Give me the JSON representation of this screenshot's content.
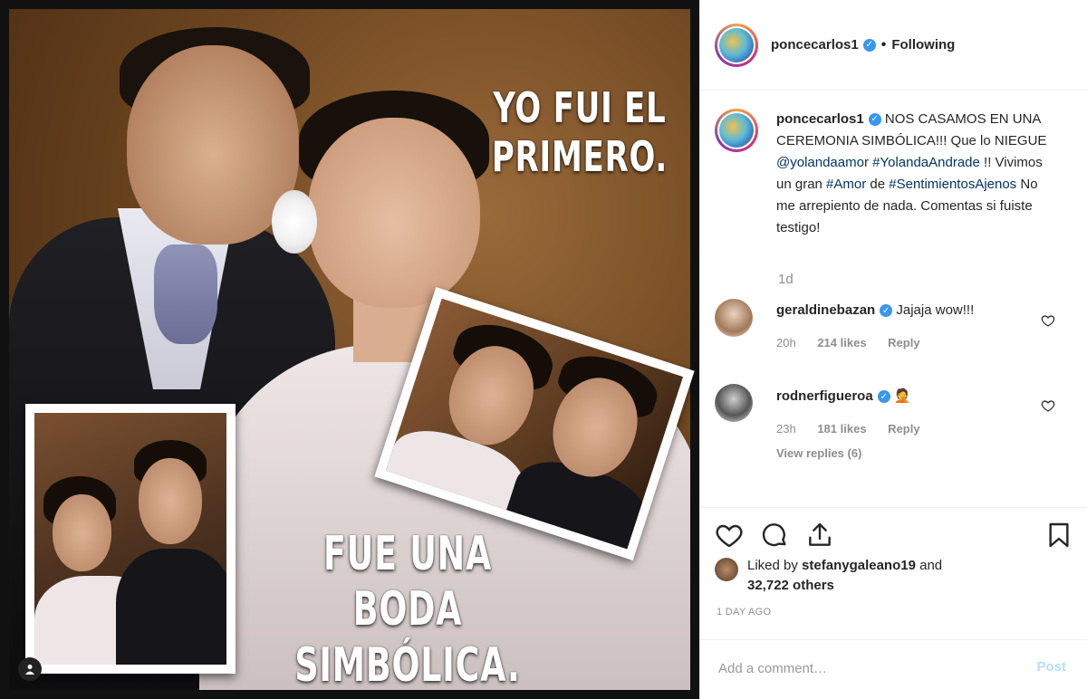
{
  "post": {
    "overlay_top_line1": "YO FUI EL",
    "overlay_top_line2": "PRIMERO.",
    "overlay_bottom_line1": "FUE UNA BODA",
    "overlay_bottom_line2": "SIMBÓLICA."
  },
  "header": {
    "username": "poncecarlos1",
    "separator": "•",
    "follow_status": "Following"
  },
  "caption": {
    "username": "poncecarlos1",
    "text_part1": " NOS CASAMOS EN UNA CEREMONIA SIMBÓLICA!!! Que lo NIEGUE ",
    "mention": "@yolandaamor",
    "hashtag1": "#YolandaAndrade",
    "text_part2": " !! Vivimos un gran ",
    "hashtag2": "#Amor",
    "text_part3": " de ",
    "hashtag3": "#SentimientosAjenos",
    "text_part4": " No me arrepiento de nada. Comentas si fuiste testigo!",
    "time_ago": "1d"
  },
  "comments": [
    {
      "username": "geraldinebazan",
      "text": "Jajaja wow!!!",
      "time": "20h",
      "likes": "214 likes",
      "reply": "Reply"
    },
    {
      "username": "rodnerfigueroa",
      "text": "🤦",
      "time": "23h",
      "likes": "181 likes",
      "reply": "Reply",
      "view_replies": "View replies (6)"
    }
  ],
  "likes": {
    "prefix": "Liked by ",
    "liker": "stefanygaleano19",
    "middle": " and",
    "count": "32,722 others"
  },
  "post_date": "1 DAY AGO",
  "comment_box": {
    "placeholder": "Add a comment…",
    "post_label": "Post"
  },
  "colors": {
    "link": "#003569",
    "verified": "#3897f0",
    "muted": "#8e8e8e",
    "post_button": "#b2dffc"
  }
}
